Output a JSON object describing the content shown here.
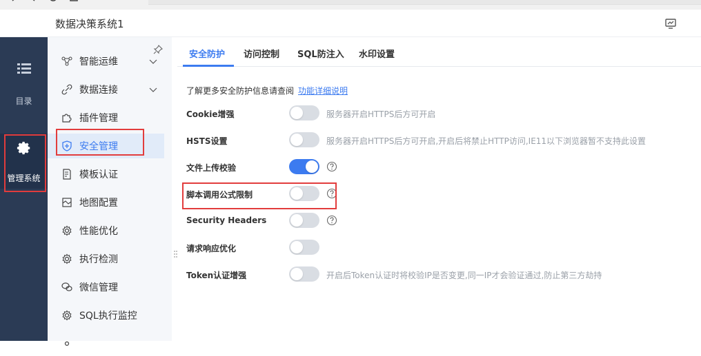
{
  "app": {
    "title": "数据决策系统1"
  },
  "leftnav": {
    "items": [
      {
        "label": "目录",
        "icon": "list-icon"
      },
      {
        "label": "管理系统",
        "icon": "gear-icon"
      }
    ]
  },
  "sidebar": {
    "items": [
      {
        "label": "智能运维",
        "icon": "network-icon",
        "expandable": true
      },
      {
        "label": "数据连接",
        "icon": "link-icon",
        "expandable": true
      },
      {
        "label": "插件管理",
        "icon": "puzzle-icon",
        "expandable": false
      },
      {
        "label": "安全管理",
        "icon": "shield-icon",
        "expandable": false,
        "active": true
      },
      {
        "label": "模板认证",
        "icon": "document-edit-icon",
        "expandable": false
      },
      {
        "label": "地图配置",
        "icon": "map-icon",
        "expandable": false
      },
      {
        "label": "性能优化",
        "icon": "gear-icon",
        "expandable": false
      },
      {
        "label": "执行检测",
        "icon": "gear-icon",
        "expandable": false
      },
      {
        "label": "微信管理",
        "icon": "wechat-icon",
        "expandable": false
      },
      {
        "label": "SQL执行监控",
        "icon": "gear-icon",
        "expandable": false
      }
    ]
  },
  "tabs": [
    {
      "label": "安全防护",
      "active": true
    },
    {
      "label": "访问控制"
    },
    {
      "label": "SQL防注入"
    },
    {
      "label": "水印设置"
    }
  ],
  "info": {
    "text": "了解更多安全防护信息请查阅",
    "link": "功能详细说明"
  },
  "settings": [
    {
      "label": "Cookie增强",
      "on": false,
      "hint": "服务器开启HTTPS后方可开启"
    },
    {
      "label": "HSTS设置",
      "on": false,
      "hint": "服务器开启HTTPS后方可开启,开启后将禁止HTTP访问,IE11以下浏览器暂不支持此设置"
    },
    {
      "label": "文件上传校验",
      "on": true,
      "hint": ""
    },
    {
      "label": "脚本调用公式限制",
      "on": false,
      "hint": ""
    },
    {
      "label": "Security Headers",
      "on": false,
      "hint": ""
    },
    {
      "label": "请求响应优化",
      "on": false,
      "hint": ""
    },
    {
      "label": "Token认证增强",
      "on": false,
      "hint": "开启后Token认证时将校验IP是否变更,同一IP才会验证通过,防止第三方劫持"
    }
  ],
  "colors": {
    "accent": "#3c7bf0",
    "nav_bg": "#2b3b55",
    "highlight": "#e23c3c"
  }
}
